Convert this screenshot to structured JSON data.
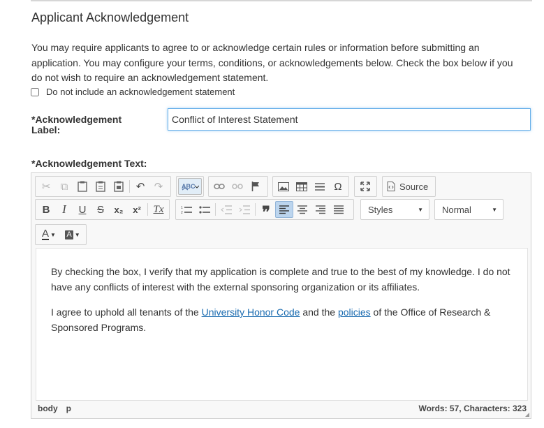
{
  "section": {
    "title": "Applicant Acknowledgement",
    "intro_line1": "You may require applicants to agree to or acknowledge certain rules or information before submitting an",
    "intro_line2": "application. You may configure your terms, conditions, or acknowledgements below. Check the box below if you",
    "intro_line3": "do not wish to require an acknowledgement statement.",
    "checkbox_label": "Do not include an acknowledgement statement"
  },
  "label_field": {
    "label_line1": "*Acknowledgement",
    "label_line2": "Label:",
    "value": "Conflict of Interest Statement"
  },
  "text_field": {
    "label": "*Acknowledgement Text:"
  },
  "toolbar": {
    "source_label": "Source",
    "styles_label": "Styles",
    "format_label": "Normal",
    "icons": {
      "cut": "✂",
      "copy": "⧉",
      "paste": "📋",
      "undo": "↶",
      "redo": "↷",
      "omega": "Ω",
      "bold": "B",
      "italic": "I",
      "underline": "U",
      "strike": "S",
      "sub": "x₂",
      "sup": "x²",
      "clear": "Tx",
      "blockquote": "❞",
      "font_color": "A",
      "bg_color": "A"
    }
  },
  "content": {
    "p1": "By checking the box, I verify that my application is complete and true to the best of my knowledge. I do not have any conflicts of interest with the external sponsoring organization or its affiliates.",
    "p2_a": "I agree to uphold all tenants of the ",
    "link1": "University Honor Code",
    "p2_b": " and the ",
    "link2": "policies",
    "p2_c": " of the Office of Research & Sponsored Programs."
  },
  "status": {
    "path_body": "body",
    "path_p": "p",
    "count": "Words: 57, Characters: 323"
  }
}
